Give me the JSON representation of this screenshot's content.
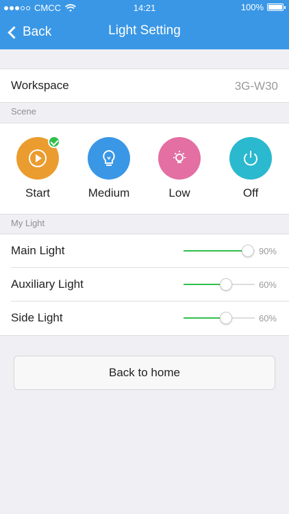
{
  "status_bar": {
    "carrier": "CMCC",
    "time": "14:21",
    "battery": "100%"
  },
  "navbar": {
    "back_label": "Back",
    "title": "Light Setting"
  },
  "workspace": {
    "label": "Workspace",
    "value": "3G-W30"
  },
  "scene": {
    "header": "Scene",
    "items": [
      {
        "label": "Start",
        "icon": "play-icon",
        "color": "#eb9c2e",
        "selected": true
      },
      {
        "label": "Medium",
        "icon": "bulb-icon",
        "color": "#3a97e6",
        "selected": false
      },
      {
        "label": "Low",
        "icon": "low-light-icon",
        "color": "#e36fa3",
        "selected": false
      },
      {
        "label": "Off",
        "icon": "power-icon",
        "color": "#2ab9cf",
        "selected": false
      }
    ]
  },
  "my_light": {
    "header": "My Light",
    "items": [
      {
        "name": "Main Light",
        "level": 0.9,
        "percent": "90%"
      },
      {
        "name": "Auxiliary Light",
        "level": 0.6,
        "percent": "60%"
      },
      {
        "name": "Side Light",
        "level": 0.6,
        "percent": "60%"
      }
    ]
  },
  "colors": {
    "accent": "#3a97e6",
    "slider_fill": "#2fbf4a"
  },
  "home_button": {
    "label": "Back to home"
  }
}
